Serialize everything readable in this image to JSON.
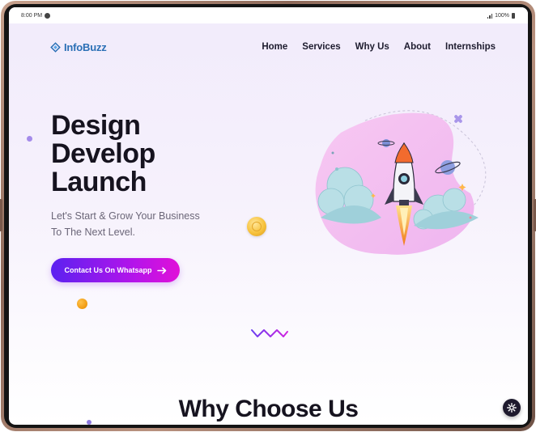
{
  "status_bar": {
    "time": "8:00 PM",
    "battery": "100%"
  },
  "brand": {
    "name": "InfoBuzz",
    "color": "#2a6fb5"
  },
  "nav": {
    "items": [
      "Home",
      "Services",
      "Why Us",
      "About",
      "Internships"
    ]
  },
  "hero": {
    "title_lines": [
      "Design",
      "Develop",
      "Launch"
    ],
    "subtitle_lines": [
      "Let's Start & Grow Your Business",
      "To The Next Level."
    ],
    "cta_label": "Contact Us On Whatsapp",
    "cta_gradient": [
      "#5b21f0",
      "#e010d8"
    ]
  },
  "section": {
    "title": "Why Choose Us"
  },
  "icons": {
    "logo": "infobuzz-logo-icon",
    "cta_arrow": "arrow-right-icon",
    "fab": "settings-icon",
    "hero_image": "rocket-launch-illustration"
  },
  "colors": {
    "background_top": "#f1ebfb",
    "heading": "#16131f",
    "accent_purple": "#7b3ff2"
  }
}
